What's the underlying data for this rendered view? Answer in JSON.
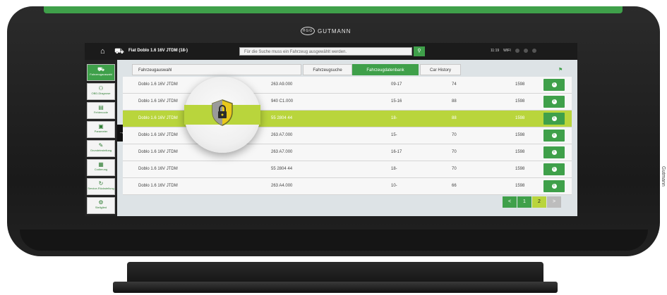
{
  "device": {
    "brand": "GUTMANN",
    "side_text": "Gutmann"
  },
  "topbar": {
    "vehicle": "Fiat Doblo 1.6 16V JTDM (18-)",
    "search_placeholder": "Für die Suche muss ein Fahrzeug ausgewählt werden.",
    "time": "11:19",
    "wifi": "WIFI"
  },
  "sidebar": {
    "items": [
      {
        "label": "Fahrzeugauswahl",
        "icon": "car-icon"
      },
      {
        "label": "OBD-Diagnose",
        "icon": "obd-icon"
      },
      {
        "label": "Fehlercode",
        "icon": "code-icon"
      },
      {
        "label": "Parameter",
        "icon": "parameter-icon"
      },
      {
        "label": "Grundeinstellung",
        "icon": "wrench-icon"
      },
      {
        "label": "Codierung",
        "icon": "coding-icon"
      },
      {
        "label": "Service-Rückstellung",
        "icon": "service-icon"
      },
      {
        "label": "Stellglied",
        "icon": "actuator-icon"
      }
    ]
  },
  "tabs": {
    "field_label": "Fahrzeugauswahl",
    "items": [
      "Fahrzeugsuche",
      "Fahrzeugdatenbank",
      "Car History"
    ]
  },
  "rows": [
    {
      "name": "Doblo 1.6 16V JTDM",
      "code": "263 A9.000",
      "years": "09-17",
      "kw": "74",
      "ccm": "1598"
    },
    {
      "name": "Doblo 1.6 16V JTDM",
      "code": "940 C1.000",
      "years": "15-16",
      "kw": "88",
      "ccm": "1598"
    },
    {
      "name": "Doblo 1.6 16V JTDM",
      "code": "55 2804 44",
      "years": "18-",
      "kw": "88",
      "ccm": "1598"
    },
    {
      "name": "Doblo 1.6 16V JTDM",
      "code": "263 A7.000",
      "years": "15-",
      "kw": "70",
      "ccm": "1598"
    },
    {
      "name": "Doblo 1.6 16V JTDM",
      "code": "263 A7.000",
      "years": "16-17",
      "kw": "70",
      "ccm": "1598"
    },
    {
      "name": "Doblo 1.6 16V JTDM",
      "code": "55 2804 44",
      "years": "18-",
      "kw": "70",
      "ccm": "1598"
    },
    {
      "name": "Doblo 1.6 16V JTDM",
      "code": "263 A4.000",
      "years": "10-",
      "kw": "66",
      "ccm": "1598"
    }
  ],
  "pager": {
    "prev": "<",
    "p1": "1",
    "p2": "2",
    "next": ">"
  },
  "colors": {
    "accent": "#3fa04a",
    "highlight": "#b9d53c"
  }
}
